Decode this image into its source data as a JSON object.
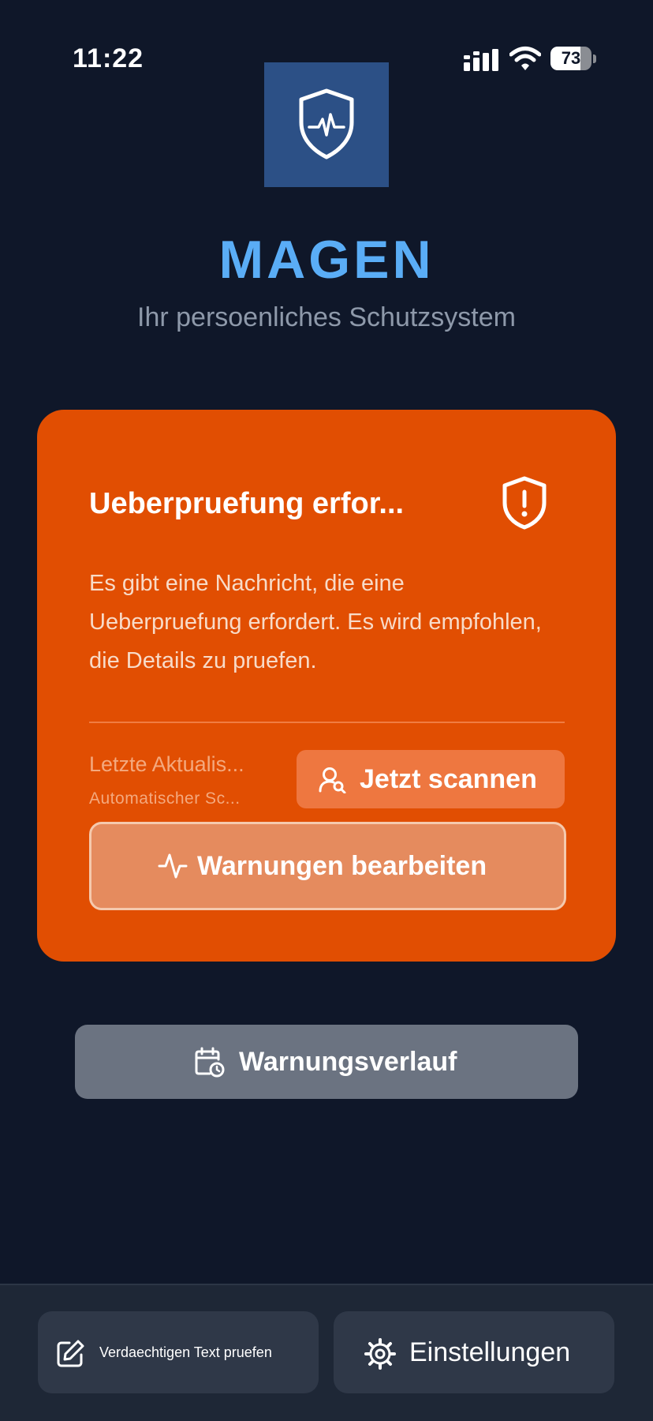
{
  "status_bar": {
    "time": "11:22",
    "battery_level": "73",
    "battery_fraction": 0.73
  },
  "app": {
    "title": "MAGEN",
    "subtitle": "Ihr persoenliches Schutzsystem",
    "logo_icon": "shield-heartbeat-icon"
  },
  "alert_card": {
    "color": "#e14e02",
    "title": "Ueberpruefung erfor...",
    "icon": "shield-alert-icon",
    "message": "Es gibt eine Nachricht, die eine Ueberpruefung erfordert. Es wird empfohlen, die Details zu pruefen.",
    "last_update": "Letzte Aktualis...",
    "auto_scan": "Automatischer Sc...",
    "scan_button": {
      "label": "Jetzt scannen",
      "icon": "user-search-icon"
    },
    "edit_button": {
      "label": "Warnungen bearbeiten",
      "icon": "activity-icon"
    }
  },
  "history_button": {
    "label": "Warnungsverlauf",
    "icon": "calendar-clock-icon"
  },
  "bottom_nav": {
    "verify": {
      "label": "Verdaechtigen Text pruefen",
      "icon": "edit-icon"
    },
    "settings": {
      "label": "Einstellungen",
      "icon": "gear-icon"
    }
  },
  "colors": {
    "background": "#0f1729",
    "accent": "#5aadf6",
    "alert": "#e14e02"
  }
}
